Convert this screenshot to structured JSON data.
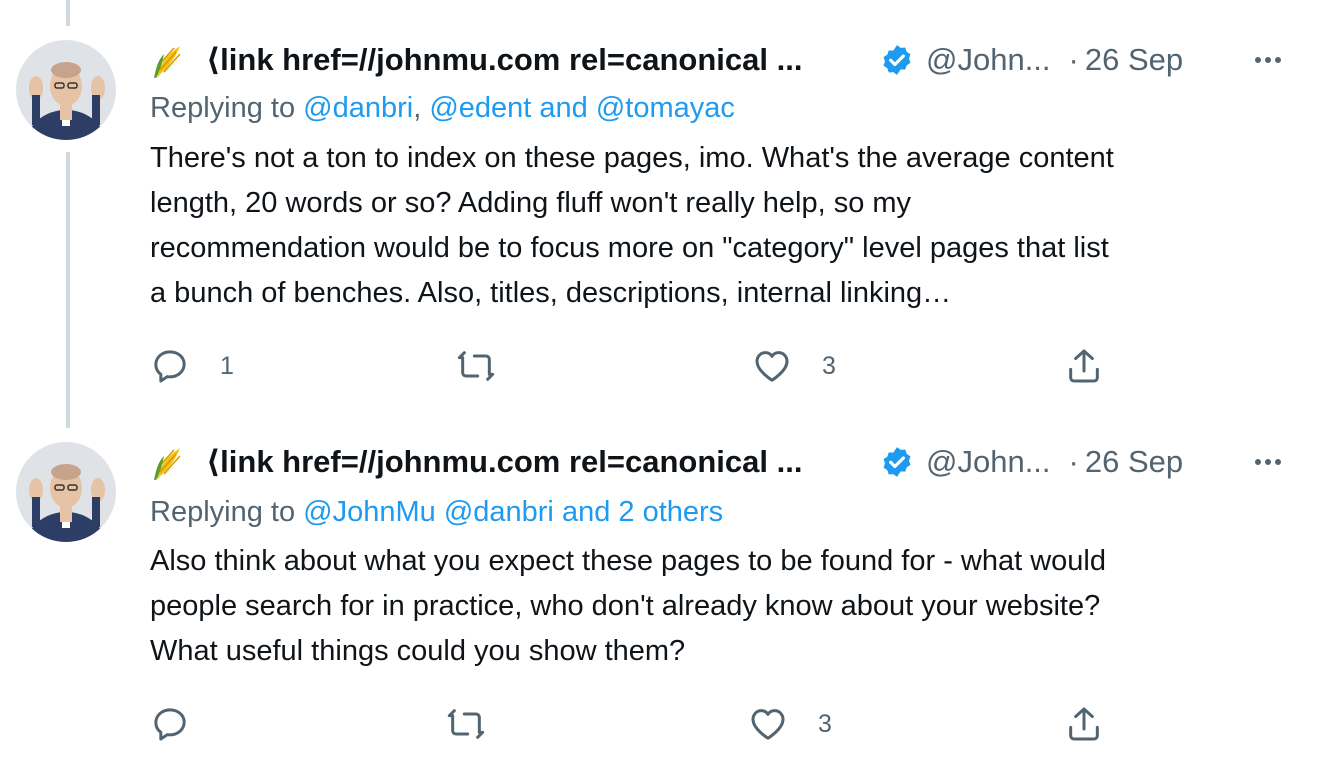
{
  "tweets": [
    {
      "display_name": "⟨link href=//johnmu.com rel=canonical ...",
      "handle": "@John...",
      "separator": "·",
      "date": "26 Sep",
      "replying_prefix": "Replying to",
      "replying_mentions": [
        "@danbri",
        ",",
        "@edent and @tomayac"
      ],
      "body_lines": [
        "There's not a ton to index on these pages, imo. What's the average content",
        "length, 20 words or so? Adding fluff won't really help, so my",
        "recommendation would be to focus more on \"category\" level pages that list",
        "a bunch of benches. Also, titles, descriptions, internal linking…"
      ],
      "reply_count": "1",
      "retweet_count": "",
      "like_count": "3"
    },
    {
      "display_name": "⟨link href=//johnmu.com rel=canonical ...",
      "handle": "@John...",
      "separator": "·",
      "date": "26 Sep",
      "replying_prefix": "Replying to",
      "replying_mentions": [
        "@JohnMu @danbri",
        "",
        " and 2 others"
      ],
      "body_lines": [
        "Also think about what you expect these pages to be found for - what would",
        "people search for in practice, who don't already know about your website?",
        "What useful things could you show them?"
      ],
      "reply_count": "",
      "retweet_count": "",
      "like_count": "3"
    }
  ],
  "colors": {
    "accent": "#1d9bf0",
    "secondary_text": "#536471",
    "thread_line": "#cfd9de"
  },
  "icons": [
    "corn-emoji-icon",
    "verified-badge-icon",
    "more-icon",
    "reply-icon",
    "retweet-icon",
    "like-icon",
    "share-icon"
  ]
}
